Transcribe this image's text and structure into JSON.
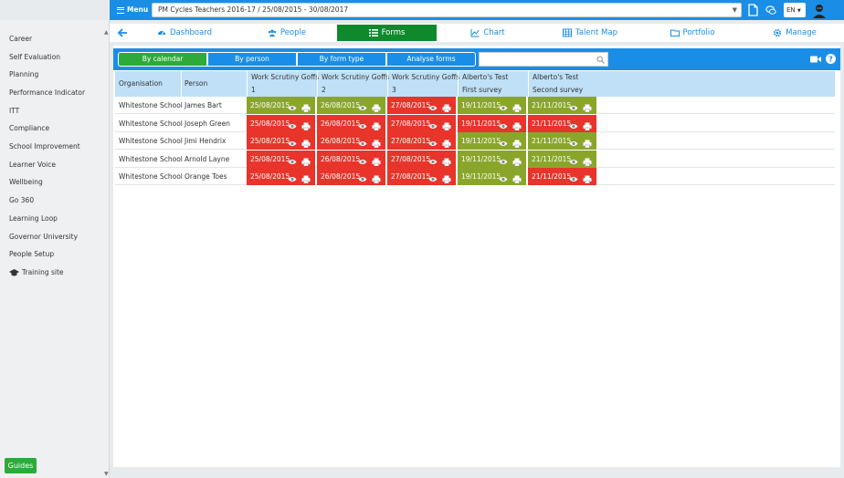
{
  "topbar": {
    "menu_label": "Menu",
    "cycle_value": "PM Cycles Teachers 2016-17 / 25/08/2015 - 30/08/2017",
    "language": "EN"
  },
  "sidebar": {
    "items": [
      {
        "label": "Career"
      },
      {
        "label": "Self Evaluation"
      },
      {
        "label": "Planning"
      },
      {
        "label": "Performance Indicator"
      },
      {
        "label": "ITT"
      },
      {
        "label": "Compliance"
      },
      {
        "label": "School Improvement"
      },
      {
        "label": "Learner Voice"
      },
      {
        "label": "Wellbeing"
      },
      {
        "label": "Go 360"
      },
      {
        "label": "Learning Loop"
      },
      {
        "label": "Governor University"
      },
      {
        "label": "People Setup"
      },
      {
        "label": "Training site"
      }
    ],
    "guides_label": "Guides"
  },
  "nav": {
    "tabs": [
      {
        "label": "Dashboard",
        "icon": "dashboard-icon"
      },
      {
        "label": "People",
        "icon": "people-icon"
      },
      {
        "label": "Forms",
        "icon": "list-icon",
        "active": true
      },
      {
        "label": "Chart",
        "icon": "chart-icon"
      },
      {
        "label": "Talent Map",
        "icon": "grid-icon"
      },
      {
        "label": "Portfolio",
        "icon": "folder-icon"
      },
      {
        "label": "Manage",
        "icon": "gear-icon"
      }
    ]
  },
  "toolbar": {
    "views": [
      "By calendar",
      "By person",
      "By form type",
      "Analyse forms"
    ],
    "active_view": "By calendar",
    "search_placeholder": ""
  },
  "table": {
    "headers": [
      {
        "line1": "Organisation",
        "line2": ""
      },
      {
        "line1": "Person",
        "line2": ""
      },
      {
        "line1": "Work Scrutiny Goffs",
        "line2": "1"
      },
      {
        "line1": "Work Scrutiny Goffs",
        "line2": "2"
      },
      {
        "line1": "Work Scrutiny Goffs",
        "line2": "3"
      },
      {
        "line1": "Alberto's Test",
        "line2": "First survey"
      },
      {
        "line1": "Alberto's Test",
        "line2": "Second survey"
      }
    ],
    "rows": [
      {
        "org": "Whitestone School",
        "person": "James Bart",
        "forms": [
          {
            "date": "25/08/2015",
            "status": "green"
          },
          {
            "date": "26/08/2015",
            "status": "green"
          },
          {
            "date": "27/08/2015",
            "status": "red"
          },
          {
            "date": "19/11/2015",
            "status": "green"
          },
          {
            "date": "21/11/2015",
            "status": "green"
          }
        ]
      },
      {
        "org": "Whitestone School",
        "person": "Joseph Green",
        "forms": [
          {
            "date": "25/08/2015",
            "status": "red"
          },
          {
            "date": "26/08/2015",
            "status": "red"
          },
          {
            "date": "27/08/2015",
            "status": "red"
          },
          {
            "date": "19/11/2015",
            "status": "red"
          },
          {
            "date": "21/11/2015",
            "status": "red"
          }
        ]
      },
      {
        "org": "Whitestone School",
        "person": "Jimi Hendrix",
        "forms": [
          {
            "date": "25/08/2015",
            "status": "red"
          },
          {
            "date": "26/08/2015",
            "status": "red"
          },
          {
            "date": "27/08/2015",
            "status": "red"
          },
          {
            "date": "19/11/2015",
            "status": "green"
          },
          {
            "date": "21/11/2015",
            "status": "green"
          }
        ]
      },
      {
        "org": "Whitestone School",
        "person": "Arnold Layne",
        "forms": [
          {
            "date": "25/08/2015",
            "status": "red"
          },
          {
            "date": "26/08/2015",
            "status": "red"
          },
          {
            "date": "27/08/2015",
            "status": "red"
          },
          {
            "date": "19/11/2015",
            "status": "green"
          },
          {
            "date": "21/11/2015",
            "status": "green"
          }
        ]
      },
      {
        "org": "Whitestone School",
        "person": "Orange Toes",
        "forms": [
          {
            "date": "25/08/2015",
            "status": "red"
          },
          {
            "date": "26/08/2015",
            "status": "red"
          },
          {
            "date": "27/08/2015",
            "status": "red"
          },
          {
            "date": "19/11/2015",
            "status": "green"
          },
          {
            "date": "21/11/2015",
            "status": "red"
          }
        ]
      }
    ]
  },
  "colors": {
    "brand_blue": "#1a8ee6",
    "active_green": "#0e8a2c",
    "status_red": "#e8342b",
    "status_green": "#8aa62a",
    "header_bg": "#bfe0f7"
  }
}
